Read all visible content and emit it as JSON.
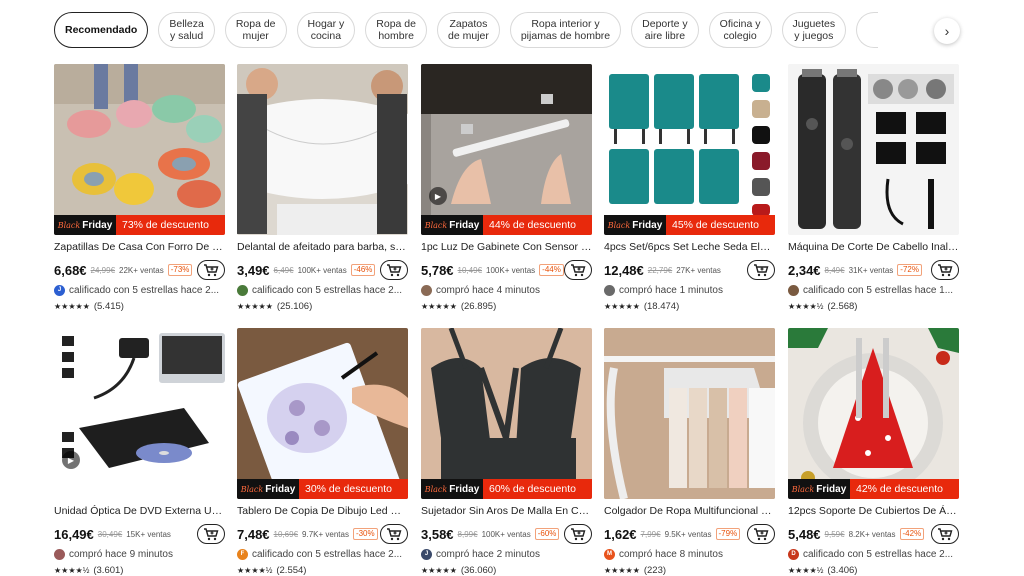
{
  "categories": [
    {
      "label": "Recomendado",
      "active": true
    },
    {
      "label": "Belleza\ny salud"
    },
    {
      "label": "Ropa de\nmujer"
    },
    {
      "label": "Hogar y\ncocina"
    },
    {
      "label": "Ropa de\nhombre"
    },
    {
      "label": "Zapatos\nde mujer"
    },
    {
      "label": "Ropa interior y\npijamas de hombre"
    },
    {
      "label": "Deporte y\naire libre"
    },
    {
      "label": "Oficina y\ncolegio"
    },
    {
      "label": "Juguetes\ny juegos"
    }
  ],
  "next_arrow": "›",
  "deal_prefix": "Black",
  "deal_word": "Friday",
  "products": [
    {
      "title": "Zapatillas De Casa Con Forro De Felp...",
      "price": "6,68€",
      "old": "24,99€",
      "sales": "22K+ ventas",
      "off": "-73%",
      "social": "calificado con 5 estrellas hace 2...",
      "avatar_letter": "J",
      "avatar_color": "#2c5fd1",
      "stars": "★★★★★",
      "reviews": "(5.415)",
      "deal": "73% de descuento"
    },
    {
      "title": "Delantal de afeitado para barba, sopo...",
      "price": "3,49€",
      "old": "6,49€",
      "sales": "100K+ ventas",
      "off": "-46%",
      "social": "calificado con 5 estrellas hace 2...",
      "avatar_letter": "",
      "avatar_color": "#4a7a3a",
      "stars": "★★★★★",
      "reviews": "(25.106)",
      "deal": ""
    },
    {
      "title": "1pc Luz De Gabinete Con Sensor De ...",
      "price": "5,78€",
      "old": "10,49€",
      "sales": "100K+ ventas",
      "off": "-44%",
      "social": "compró hace 4 minutos",
      "avatar_letter": "",
      "avatar_color": "#8a6a55",
      "stars": "★★★★★",
      "reviews": "(26.895)",
      "deal": "44% de descuento"
    },
    {
      "title": "4pcs Set/6pcs Set Leche Seda Elástic...",
      "price": "12,48€",
      "old": "22,79€",
      "sales": "27K+ ventas",
      "off": "",
      "social": "compró hace 1 minutos",
      "avatar_letter": "",
      "avatar_color": "#6a6a6a",
      "stars": "★★★★★",
      "reviews": "(18.474)",
      "deal": "45% de descuento"
    },
    {
      "title": "Máquina De Corte De Cabello Inalám...",
      "price": "2,34€",
      "old": "8,49€",
      "sales": "31K+ ventas",
      "off": "-72%",
      "social": "calificado con 5 estrellas hace 1...",
      "avatar_letter": "",
      "avatar_color": "#7a5a40",
      "stars": "★★★★½",
      "reviews": "(2.568)",
      "deal": ""
    },
    {
      "title": "Unidad Óptica De DVD Externa USB2....",
      "price": "16,49€",
      "old": "30,49€",
      "sales": "15K+ ventas",
      "off": "",
      "social": "compró hace 9 minutos",
      "avatar_letter": "",
      "avatar_color": "#9a5a5a",
      "stars": "★★★★½",
      "reviews": "(3.601)",
      "deal": ""
    },
    {
      "title": "Tablero De Copia De Dibujo Led Regul...",
      "price": "7,48€",
      "old": "10,69€",
      "sales": "9.7K+ ventas",
      "off": "-30%",
      "social": "calificado con 5 estrellas hace 2...",
      "avatar_letter": "F",
      "avatar_color": "#e8821c",
      "stars": "★★★★½",
      "reviews": "(2.554)",
      "deal": "30% de descuento"
    },
    {
      "title": "Sujetador Sin Aros De Malla En Contr...",
      "price": "3,58€",
      "old": "8,99€",
      "sales": "100K+ ventas",
      "off": "-60%",
      "social": "compró hace 2 minutos",
      "avatar_letter": "J",
      "avatar_color": "#3a4a6a",
      "stars": "★★★★★",
      "reviews": "(36.060)",
      "deal": "60% de descuento"
    },
    {
      "title": "Colgador De Ropa Multifuncional Blan...",
      "price": "1,62€",
      "old": "7,99€",
      "sales": "9.5K+ ventas",
      "off": "-79%",
      "social": "compró hace 8 minutos",
      "avatar_letter": "M",
      "avatar_color": "#e8531c",
      "stars": "★★★★★",
      "reviews": "(223)",
      "deal": ""
    },
    {
      "title": "12pcs Soporte De Cubiertos De Árbol...",
      "price": "5,48€",
      "old": "9,59€",
      "sales": "8.2K+ ventas",
      "off": "-42%",
      "social": "calificado con 5 estrellas hace 2...",
      "avatar_letter": "D",
      "avatar_color": "#c8381c",
      "stars": "★★★★½",
      "reviews": "(3.406)",
      "deal": "42% de descuento"
    }
  ]
}
